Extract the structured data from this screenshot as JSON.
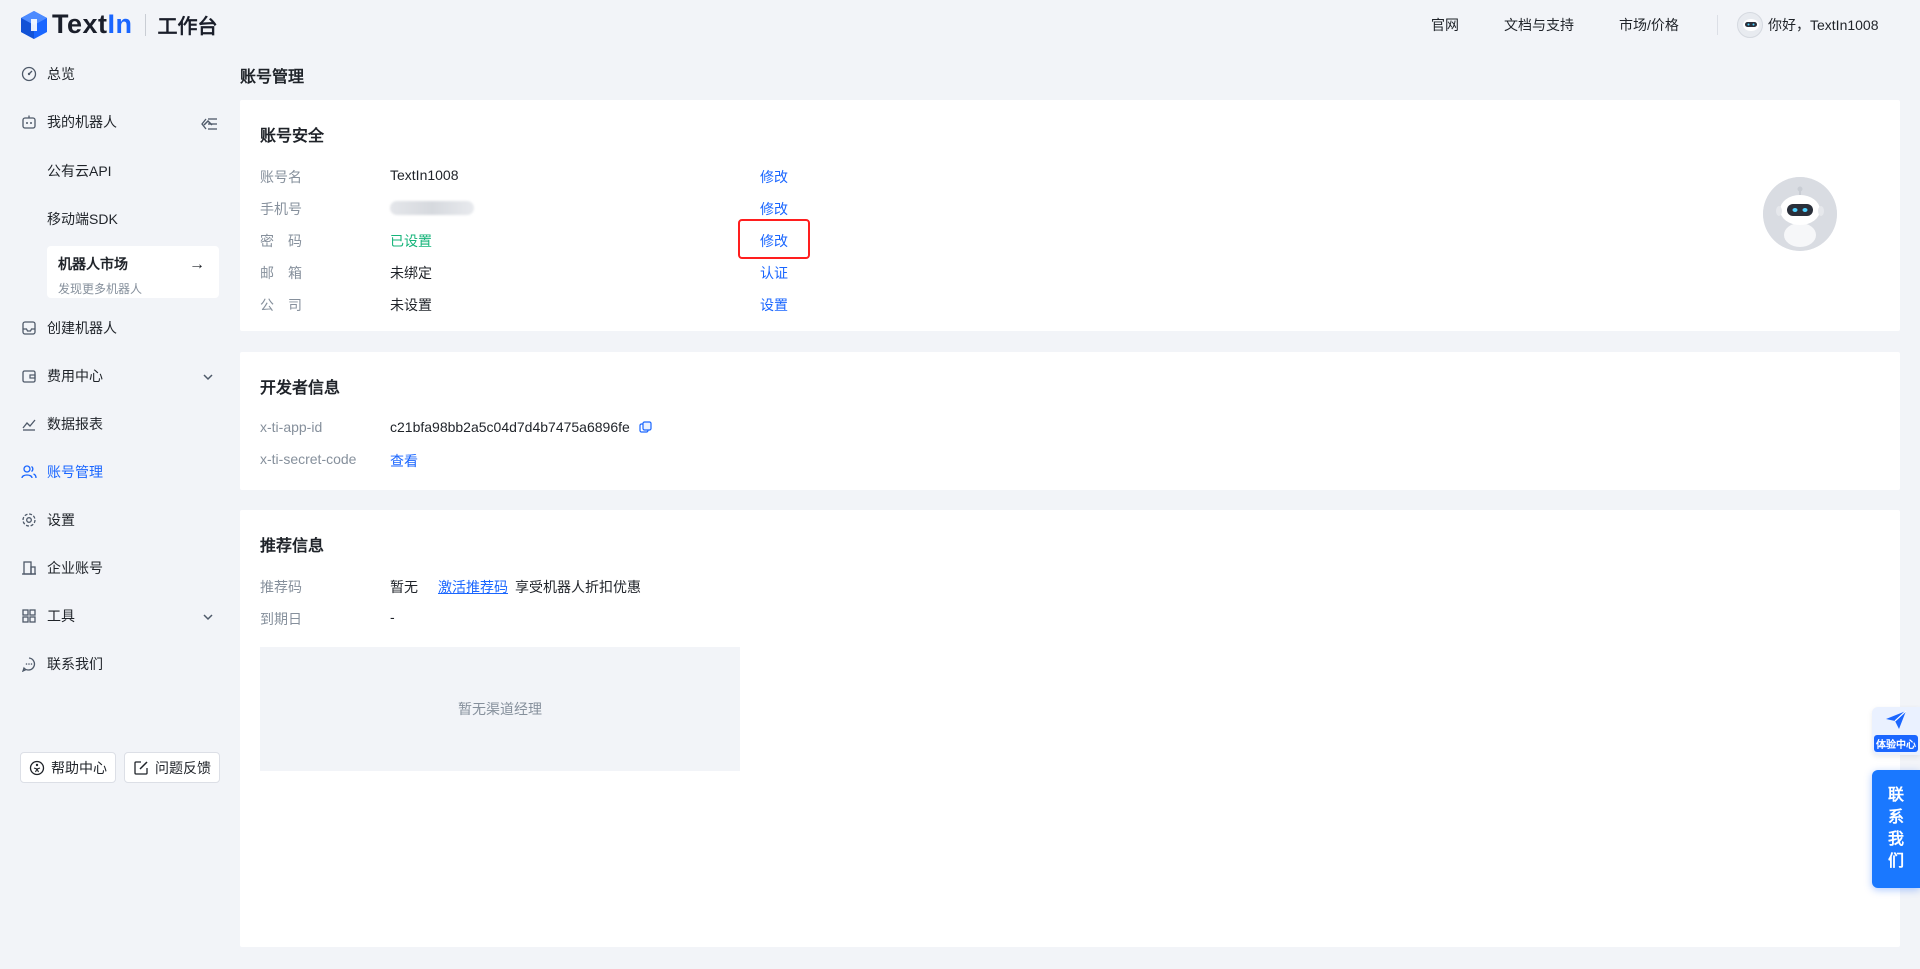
{
  "brand": {
    "name_dark": "Text",
    "name_blue": "In",
    "subtitle": "工作台"
  },
  "topnav": {
    "items": [
      "官网",
      "文档与支持",
      "市场/价格"
    ],
    "greeting": "你好，TextIn1008"
  },
  "sidebar": {
    "overview": "总览",
    "my_robots": "我的机器人",
    "public_api": "公有云API",
    "mobile_sdk": "移动端SDK",
    "market_title": "机器人市场",
    "market_sub": "发现更多机器人",
    "create_robot": "创建机器人",
    "billing": "费用中心",
    "reports": "数据报表",
    "account": "账号管理",
    "settings": "设置",
    "enterprise": "企业账号",
    "tools": "工具",
    "contact": "联系我们",
    "help_center": "帮助中心",
    "feedback": "问题反馈"
  },
  "page": {
    "title": "账号管理"
  },
  "security": {
    "title": "账号安全",
    "rows": [
      {
        "label": "账号名",
        "value": "TextIn1008",
        "action": "修改"
      },
      {
        "label": "手机号",
        "value": "",
        "action": "修改"
      },
      {
        "label": "密　码",
        "value": "已设置",
        "action": "修改"
      },
      {
        "label": "邮　箱",
        "value": "未绑定",
        "action": "认证"
      },
      {
        "label": "公　司",
        "value": "未设置",
        "action": "设置"
      }
    ]
  },
  "developer": {
    "title": "开发者信息",
    "app_id_label": "x-ti-app-id",
    "app_id_value": "c21bfa98bb2a5c04d7d4b7475a6896fe",
    "secret_label": "x-ti-secret-code",
    "secret_action": "查看"
  },
  "referral": {
    "title": "推荐信息",
    "code_label": "推荐码",
    "code_value": "暂无",
    "activate_link": "激活推荐码",
    "activate_desc": "享受机器人折扣优惠",
    "expiry_label": "到期日",
    "expiry_value": "-",
    "empty_text": "暂无渠道经理"
  },
  "float": {
    "experience": "体验中心",
    "contact": [
      "联",
      "系",
      "我",
      "们"
    ]
  },
  "colors": {
    "accent": "#1a66ff",
    "success": "#16b47a",
    "highlight": "#ff1e1e",
    "muted": "#86909c"
  }
}
